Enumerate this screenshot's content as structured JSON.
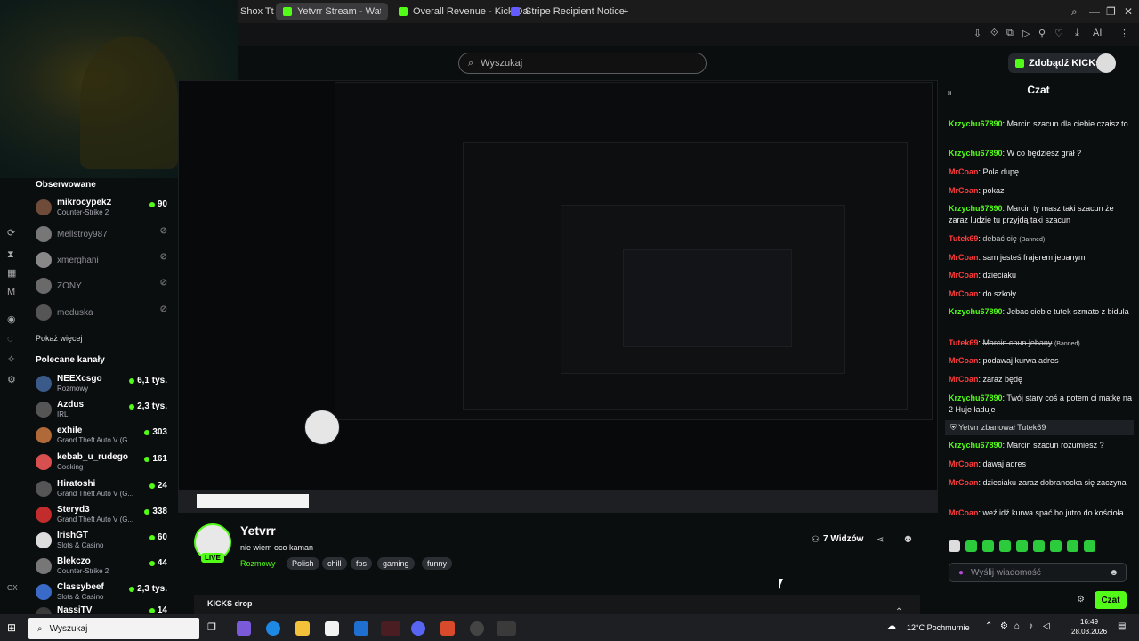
{
  "browser": {
    "tabs": [
      {
        "label": "Shox Tt",
        "active": false,
        "favicon": "tiktok-icon"
      },
      {
        "label": "Yetvrr Stream - Watch Live",
        "active": true,
        "favicon": "kick-icon"
      },
      {
        "label": "Overall Revenue - Kick Da",
        "active": false,
        "favicon": "kick-icon"
      },
      {
        "label": "Stripe Recipient Notice",
        "active": false,
        "favicon": "stripe-icon"
      }
    ],
    "new_tab": "+",
    "window_controls": {
      "search": "⌕",
      "minimize": "—",
      "restore": "❐",
      "close": "✕"
    },
    "toolbar_label": "AI"
  },
  "header": {
    "search_placeholder": "Wyszukaj",
    "get_kicks": "Zdobądź KICKs"
  },
  "sidebar": {
    "followed_title": "Obserwowane",
    "followed": [
      {
        "name": "mikrocypek2",
        "category": "Counter-Strike 2",
        "viewers": "90",
        "online": true,
        "color": "#6f4b3a"
      },
      {
        "name": "Mellstroy987",
        "category": "",
        "viewers": "",
        "online": false,
        "color": "#777"
      },
      {
        "name": "xmerghani",
        "category": "",
        "viewers": "",
        "online": false,
        "color": "#888"
      },
      {
        "name": "ZONY",
        "category": "",
        "viewers": "",
        "online": false,
        "color": "#6a6a6a"
      },
      {
        "name": "meduska",
        "category": "",
        "viewers": "",
        "online": false,
        "color": "#555"
      }
    ],
    "show_more": "Pokaż więcej",
    "recommended_title": "Polecane kanały",
    "recommended": [
      {
        "name": "NEEXcsgo",
        "category": "Rozmowy",
        "viewers": "6,1 tys.",
        "color": "#3a5a8a"
      },
      {
        "name": "Azdus",
        "category": "IRL",
        "viewers": "2,3 tys.",
        "color": "#555"
      },
      {
        "name": "exhile",
        "category": "Grand Theft Auto V (G...",
        "viewers": "303",
        "color": "#b06a3a"
      },
      {
        "name": "kebab_u_rudego",
        "category": "Cooking",
        "viewers": "161",
        "color": "#d84f4f"
      },
      {
        "name": "Hiratoshi",
        "category": "Grand Theft Auto V (G...",
        "viewers": "24",
        "color": "#555"
      },
      {
        "name": "Steryd3",
        "category": "Grand Theft Auto V (G...",
        "viewers": "338",
        "color": "#c32c2c"
      },
      {
        "name": "IrishGT",
        "category": "Slots & Casino",
        "viewers": "60",
        "color": "#ddd"
      },
      {
        "name": "Blekczo",
        "category": "Counter-Strike 2",
        "viewers": "44",
        "color": "#777"
      },
      {
        "name": "Classybeef",
        "category": "Slots & Casino",
        "viewers": "2,3 tys.",
        "color": "#3a6ac8"
      },
      {
        "name": "NassiTV",
        "category": "",
        "viewers": "14",
        "color": "#3a3a3a"
      }
    ],
    "gx_label": "GX"
  },
  "stream": {
    "streamer": "Yetvrr",
    "title": "nie wiem oco kaman",
    "category": "Rozmowy",
    "tags": [
      "Polish",
      "chill",
      "fps",
      "gaming",
      "funny"
    ],
    "viewers": "7 Widzów",
    "live": "LIVE",
    "drops_title": "KICKS drop"
  },
  "chat": {
    "title": "Czat",
    "messages": [
      {
        "user": "Krzychu67890",
        "color": "green",
        "text": "Marcin szacun dla ciebie czaisz to"
      },
      {
        "user": "Krzychu67890",
        "color": "green",
        "text": "W co będziesz grał ?"
      },
      {
        "user": "MrCoan",
        "color": "red",
        "text": "Pola dupę"
      },
      {
        "user": "MrCoan",
        "color": "red",
        "text": "pokaz"
      },
      {
        "user": "Krzychu67890",
        "color": "green",
        "text": "Marcin ty masz taki szacun że zaraz ludzie tu przyjdą taki szacun"
      },
      {
        "user": "Tutek69",
        "color": "red",
        "text": "debać cię",
        "banned": "(Banned)"
      },
      {
        "user": "MrCoan",
        "color": "red",
        "text": "sam jesteś frajerem jebanym"
      },
      {
        "user": "MrCoan",
        "color": "red",
        "text": "dzieciaku"
      },
      {
        "user": "MrCoan",
        "color": "red",
        "text": "do szkoły"
      },
      {
        "user": "Krzychu67890",
        "color": "green",
        "text": "Jebac ciebie tutek szmato z bidula"
      },
      {
        "user": "Tutek69",
        "color": "red",
        "text": "Marcin cpun jebany",
        "banned": "(Banned)"
      },
      {
        "user": "MrCoan",
        "color": "red",
        "text": "podawaj kurwa adres"
      },
      {
        "user": "MrCoan",
        "color": "red",
        "text": "zaraz będę"
      },
      {
        "user": "Krzychu67890",
        "color": "green",
        "text": "Twój stary coś a potem ci matkę na 2 Huje ładuje"
      },
      {
        "system": "Yetvrr zbanował Tutek69"
      },
      {
        "user": "Krzychu67890",
        "color": "green",
        "text": "Marcin szacun rozumiesz ?"
      },
      {
        "user": "MrCoan",
        "color": "red",
        "text": "dawaj adres"
      },
      {
        "user": "MrCoan",
        "color": "red",
        "text": "dzieciaku zaraz dobranocka się zaczyna"
      },
      {
        "user": "MrCoan",
        "color": "red",
        "text": "weź idź kurwa spać bo jutro do kościoła"
      }
    ],
    "input_placeholder": "Wyślij wiadomość",
    "send_button": "Czat"
  },
  "taskbar": {
    "search_placeholder": "Wyszukaj",
    "weather": "12°C  Pochmurnie",
    "time": "16:49",
    "date": "28.03.2026"
  },
  "colors": {
    "accent": "#53fc18",
    "username_red": "#ff3b3b",
    "background": "#0b0e0f"
  }
}
